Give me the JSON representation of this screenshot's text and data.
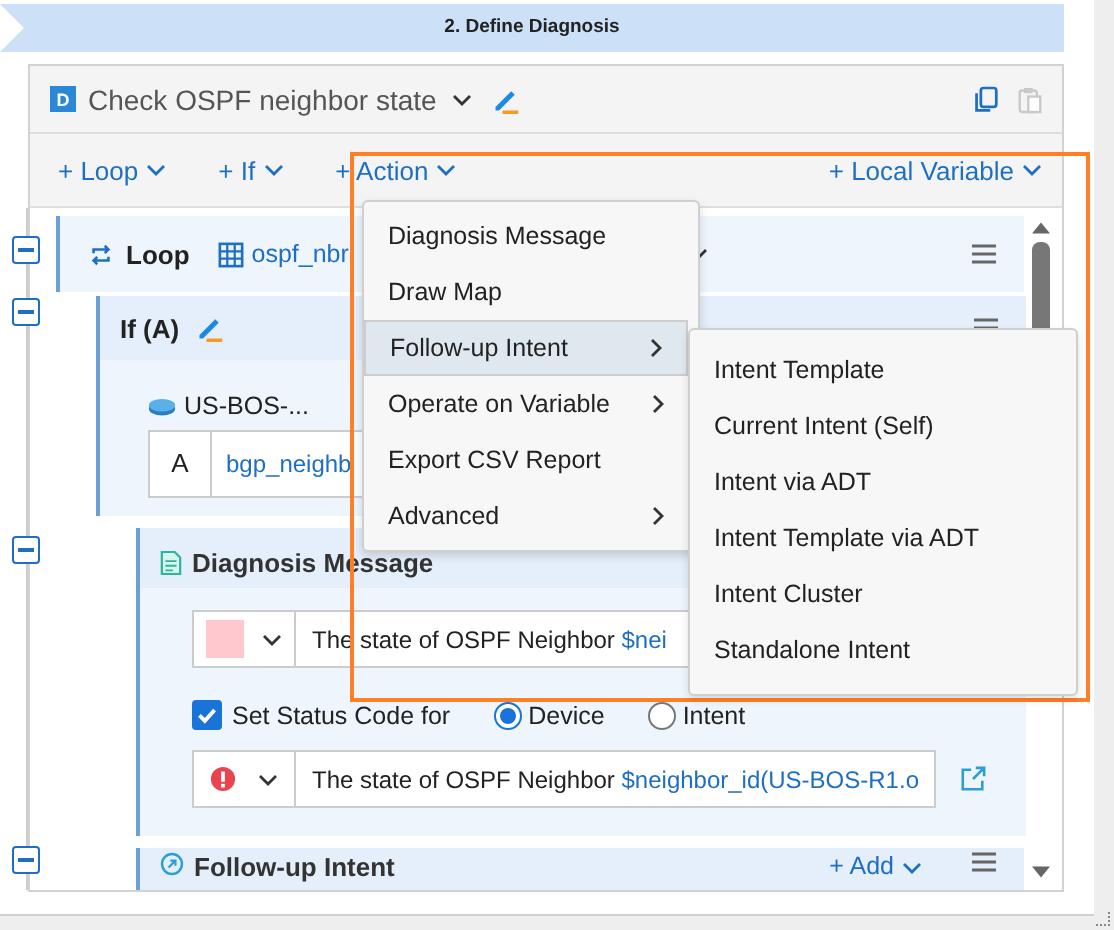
{
  "banner": {
    "title": "2. Define Diagnosis"
  },
  "header": {
    "badge": "D",
    "title": "Check OSPF neighbor state"
  },
  "toolbar": {
    "items": [
      {
        "label": "+ Loop"
      },
      {
        "label": "+ If"
      },
      {
        "label": "+ Action"
      }
    ],
    "right": {
      "label": "+ Local Variable"
    }
  },
  "loop": {
    "label": "Loop",
    "variable": "ospf_nbr"
  },
  "if_block": {
    "label": "If (A)",
    "device": "US-BOS-...",
    "condition": {
      "letter": "A",
      "expression": "bgp_neighb"
    }
  },
  "diagnosis_message": {
    "title": "Diagnosis Message",
    "color": "#ffc7ce",
    "message": "The state of OSPF Neighbor",
    "variable": "$nei",
    "status_code": {
      "checked": true,
      "label": "Set Status Code for",
      "options": [
        {
          "label": "Device",
          "selected": true
        },
        {
          "label": "Intent",
          "selected": false
        }
      ]
    },
    "status_message": "The state of OSPF Neighbor",
    "status_variable": "$neighbor_id(US-BOS-R1.o"
  },
  "follow_up": {
    "title": "Follow-up Intent",
    "add": "+ Add"
  },
  "action_menu": {
    "items": [
      {
        "label": "Diagnosis Message",
        "submenu": false,
        "selected": false
      },
      {
        "label": "Draw Map",
        "submenu": false,
        "selected": false
      },
      {
        "label": "Follow-up Intent",
        "submenu": true,
        "selected": true
      },
      {
        "label": "Operate on Variable",
        "submenu": true,
        "selected": false
      },
      {
        "label": "Export CSV Report",
        "submenu": false,
        "selected": false
      },
      {
        "label": "Advanced",
        "submenu": true,
        "selected": false
      }
    ]
  },
  "submenu": {
    "items": [
      "Intent Template",
      "Current Intent (Self)",
      "Intent via ADT",
      "Intent Template via ADT",
      "Intent Cluster",
      "Standalone Intent"
    ]
  }
}
